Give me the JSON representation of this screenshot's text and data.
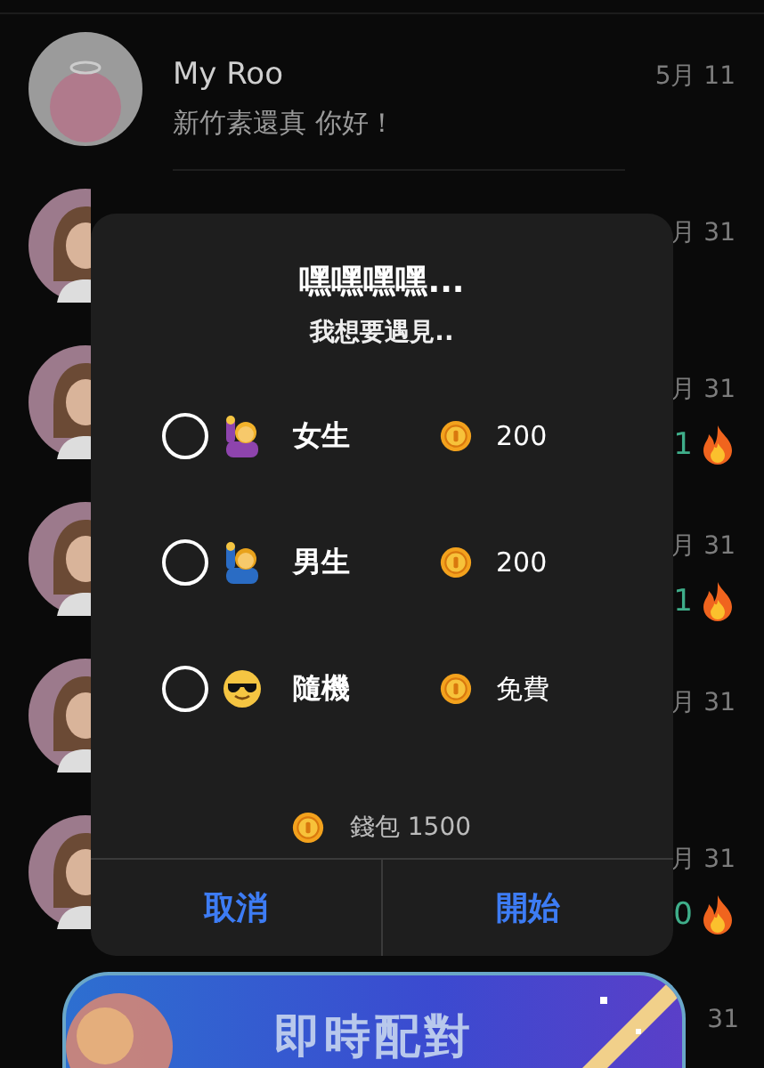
{
  "chats": [
    {
      "name": "My Roo",
      "message": "新竹素還真 你好！",
      "date": "5月 11",
      "kind": "mascot"
    },
    {
      "date": "月 31",
      "kind": "person"
    },
    {
      "date": "月 31",
      "count": "1",
      "kind": "person"
    },
    {
      "date": "月 31",
      "count": "1",
      "kind": "person"
    },
    {
      "date": "月 31",
      "kind": "person"
    },
    {
      "date": "月 31",
      "count": "0",
      "kind": "person"
    }
  ],
  "banner": {
    "label": "即時配對",
    "date": "31"
  },
  "dialog": {
    "title": "嘿嘿嘿嘿...",
    "subtitle": "我想要遇見..",
    "options": [
      {
        "kind": "girl",
        "label": "女生",
        "price": "200",
        "selected": false
      },
      {
        "kind": "boy",
        "label": "男生",
        "price": "200",
        "selected": false
      },
      {
        "kind": "random",
        "label": "隨機",
        "price": "免費",
        "selected": false
      }
    ],
    "wallet": "錢包 1500",
    "buttons": [
      "取消",
      "開始"
    ]
  }
}
